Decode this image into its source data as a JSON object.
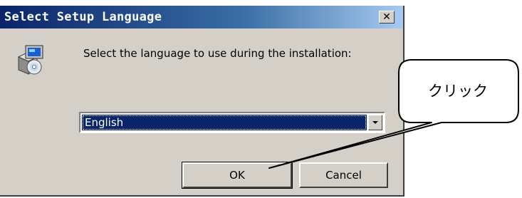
{
  "dialog": {
    "title": "Select Setup Language",
    "close_icon": "close-icon",
    "setup_icon": "installer-icon",
    "prompt": "Select the language to use during the installation:",
    "language": {
      "selected": "English"
    },
    "buttons": {
      "ok": "OK",
      "cancel": "Cancel"
    }
  },
  "callout": {
    "label": "クリック"
  },
  "colors": {
    "titlebar_start": "#0a246a",
    "titlebar_end": "#a6caf0",
    "dialog_face": "#d4d0c8",
    "selection": "#0a246a"
  }
}
